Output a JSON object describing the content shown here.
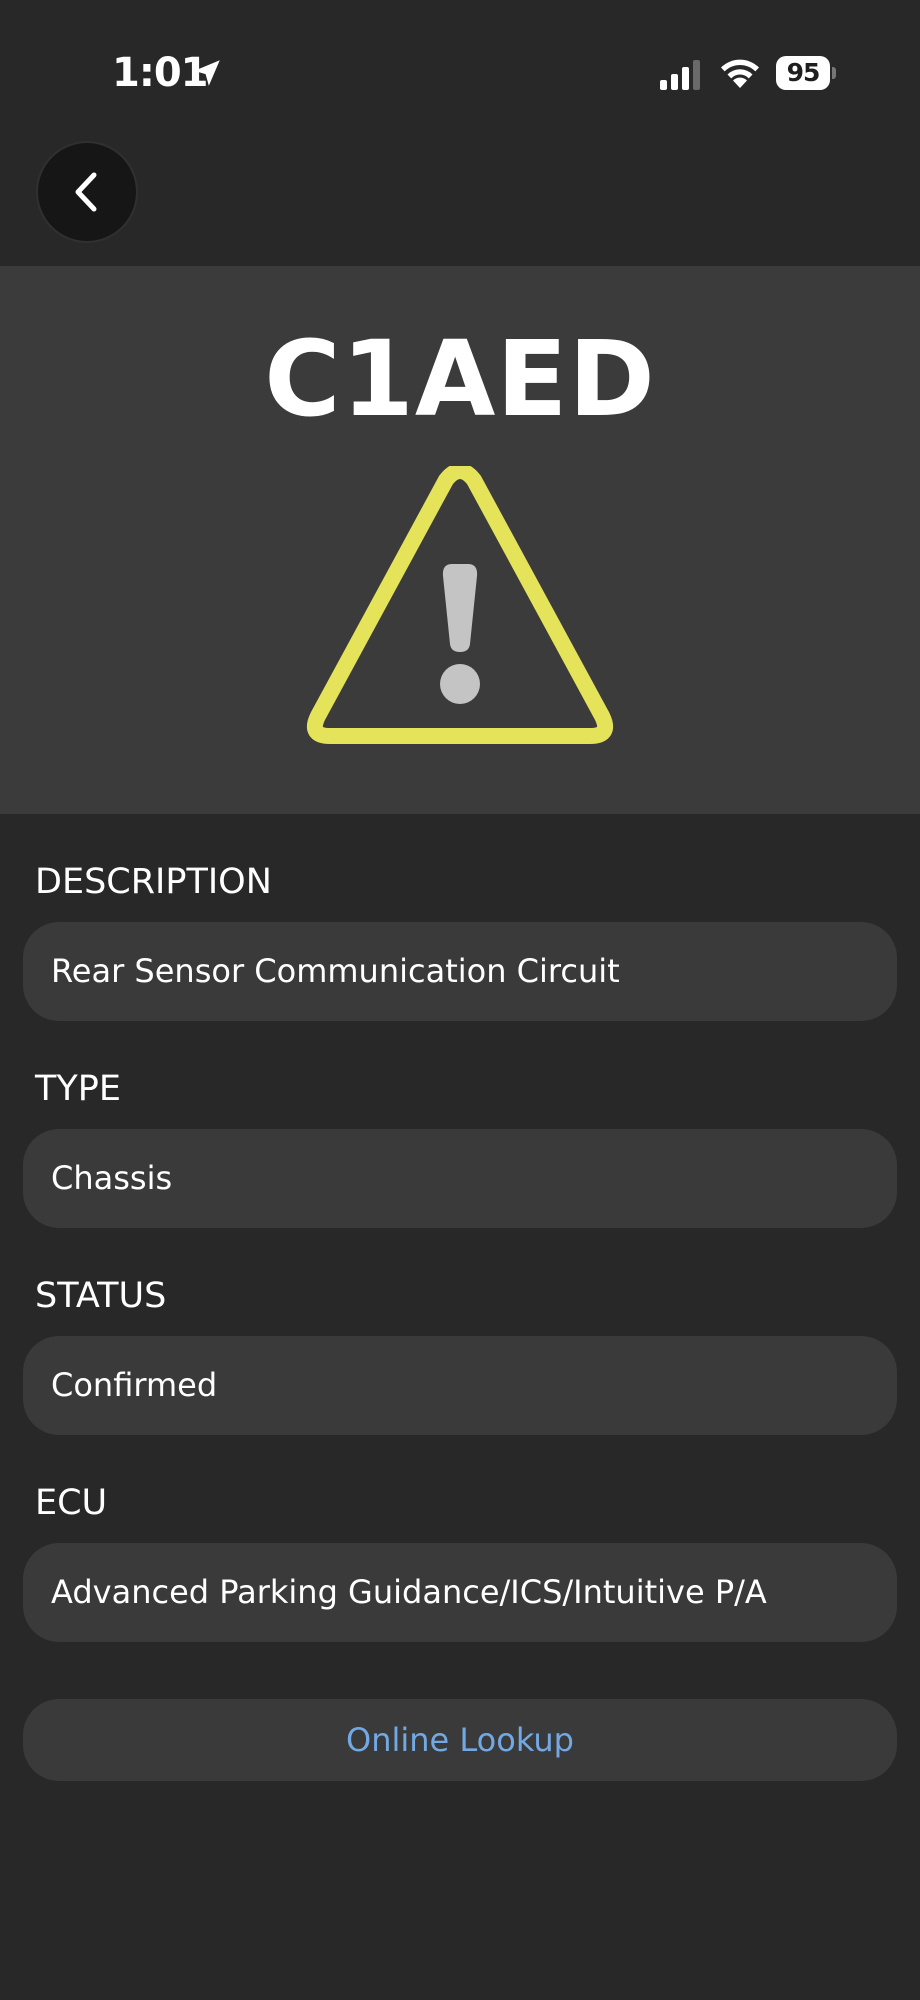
{
  "status_bar": {
    "time": "1:01",
    "battery": "95",
    "icons": [
      "location-arrow-icon",
      "cellular-signal-icon",
      "wifi-icon",
      "battery-icon"
    ]
  },
  "navigation": {
    "back_icon": "chevron-left-icon"
  },
  "dtc": {
    "code": "C1AED",
    "icon": "warning-triangle-icon",
    "icon_color": "#e4e35a"
  },
  "fields": {
    "description": {
      "label": "DESCRIPTION",
      "value": "Rear Sensor Communication Circuit"
    },
    "type": {
      "label": "TYPE",
      "value": "Chassis"
    },
    "status": {
      "label": "STATUS",
      "value": "Confirmed"
    },
    "ecu": {
      "label": "ECU",
      "value": "Advanced Parking Guidance/ICS/Intuitive P/A"
    }
  },
  "actions": {
    "online_lookup_label": "Online Lookup",
    "link_color": "#72a8e4"
  }
}
